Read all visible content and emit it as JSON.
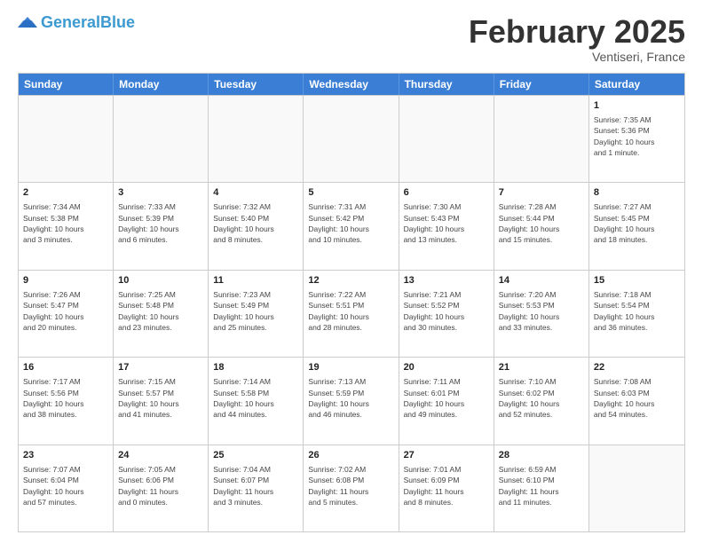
{
  "header": {
    "logo_line1": "General",
    "logo_line2": "Blue",
    "title": "February 2025",
    "subtitle": "Ventiseri, France"
  },
  "days_of_week": [
    "Sunday",
    "Monday",
    "Tuesday",
    "Wednesday",
    "Thursday",
    "Friday",
    "Saturday"
  ],
  "weeks": [
    [
      {
        "day": "",
        "info": ""
      },
      {
        "day": "",
        "info": ""
      },
      {
        "day": "",
        "info": ""
      },
      {
        "day": "",
        "info": ""
      },
      {
        "day": "",
        "info": ""
      },
      {
        "day": "",
        "info": ""
      },
      {
        "day": "1",
        "info": "Sunrise: 7:35 AM\nSunset: 5:36 PM\nDaylight: 10 hours\nand 1 minute."
      }
    ],
    [
      {
        "day": "2",
        "info": "Sunrise: 7:34 AM\nSunset: 5:38 PM\nDaylight: 10 hours\nand 3 minutes."
      },
      {
        "day": "3",
        "info": "Sunrise: 7:33 AM\nSunset: 5:39 PM\nDaylight: 10 hours\nand 6 minutes."
      },
      {
        "day": "4",
        "info": "Sunrise: 7:32 AM\nSunset: 5:40 PM\nDaylight: 10 hours\nand 8 minutes."
      },
      {
        "day": "5",
        "info": "Sunrise: 7:31 AM\nSunset: 5:42 PM\nDaylight: 10 hours\nand 10 minutes."
      },
      {
        "day": "6",
        "info": "Sunrise: 7:30 AM\nSunset: 5:43 PM\nDaylight: 10 hours\nand 13 minutes."
      },
      {
        "day": "7",
        "info": "Sunrise: 7:28 AM\nSunset: 5:44 PM\nDaylight: 10 hours\nand 15 minutes."
      },
      {
        "day": "8",
        "info": "Sunrise: 7:27 AM\nSunset: 5:45 PM\nDaylight: 10 hours\nand 18 minutes."
      }
    ],
    [
      {
        "day": "9",
        "info": "Sunrise: 7:26 AM\nSunset: 5:47 PM\nDaylight: 10 hours\nand 20 minutes."
      },
      {
        "day": "10",
        "info": "Sunrise: 7:25 AM\nSunset: 5:48 PM\nDaylight: 10 hours\nand 23 minutes."
      },
      {
        "day": "11",
        "info": "Sunrise: 7:23 AM\nSunset: 5:49 PM\nDaylight: 10 hours\nand 25 minutes."
      },
      {
        "day": "12",
        "info": "Sunrise: 7:22 AM\nSunset: 5:51 PM\nDaylight: 10 hours\nand 28 minutes."
      },
      {
        "day": "13",
        "info": "Sunrise: 7:21 AM\nSunset: 5:52 PM\nDaylight: 10 hours\nand 30 minutes."
      },
      {
        "day": "14",
        "info": "Sunrise: 7:20 AM\nSunset: 5:53 PM\nDaylight: 10 hours\nand 33 minutes."
      },
      {
        "day": "15",
        "info": "Sunrise: 7:18 AM\nSunset: 5:54 PM\nDaylight: 10 hours\nand 36 minutes."
      }
    ],
    [
      {
        "day": "16",
        "info": "Sunrise: 7:17 AM\nSunset: 5:56 PM\nDaylight: 10 hours\nand 38 minutes."
      },
      {
        "day": "17",
        "info": "Sunrise: 7:15 AM\nSunset: 5:57 PM\nDaylight: 10 hours\nand 41 minutes."
      },
      {
        "day": "18",
        "info": "Sunrise: 7:14 AM\nSunset: 5:58 PM\nDaylight: 10 hours\nand 44 minutes."
      },
      {
        "day": "19",
        "info": "Sunrise: 7:13 AM\nSunset: 5:59 PM\nDaylight: 10 hours\nand 46 minutes."
      },
      {
        "day": "20",
        "info": "Sunrise: 7:11 AM\nSunset: 6:01 PM\nDaylight: 10 hours\nand 49 minutes."
      },
      {
        "day": "21",
        "info": "Sunrise: 7:10 AM\nSunset: 6:02 PM\nDaylight: 10 hours\nand 52 minutes."
      },
      {
        "day": "22",
        "info": "Sunrise: 7:08 AM\nSunset: 6:03 PM\nDaylight: 10 hours\nand 54 minutes."
      }
    ],
    [
      {
        "day": "23",
        "info": "Sunrise: 7:07 AM\nSunset: 6:04 PM\nDaylight: 10 hours\nand 57 minutes."
      },
      {
        "day": "24",
        "info": "Sunrise: 7:05 AM\nSunset: 6:06 PM\nDaylight: 11 hours\nand 0 minutes."
      },
      {
        "day": "25",
        "info": "Sunrise: 7:04 AM\nSunset: 6:07 PM\nDaylight: 11 hours\nand 3 minutes."
      },
      {
        "day": "26",
        "info": "Sunrise: 7:02 AM\nSunset: 6:08 PM\nDaylight: 11 hours\nand 5 minutes."
      },
      {
        "day": "27",
        "info": "Sunrise: 7:01 AM\nSunset: 6:09 PM\nDaylight: 11 hours\nand 8 minutes."
      },
      {
        "day": "28",
        "info": "Sunrise: 6:59 AM\nSunset: 6:10 PM\nDaylight: 11 hours\nand 11 minutes."
      },
      {
        "day": "",
        "info": ""
      }
    ]
  ]
}
